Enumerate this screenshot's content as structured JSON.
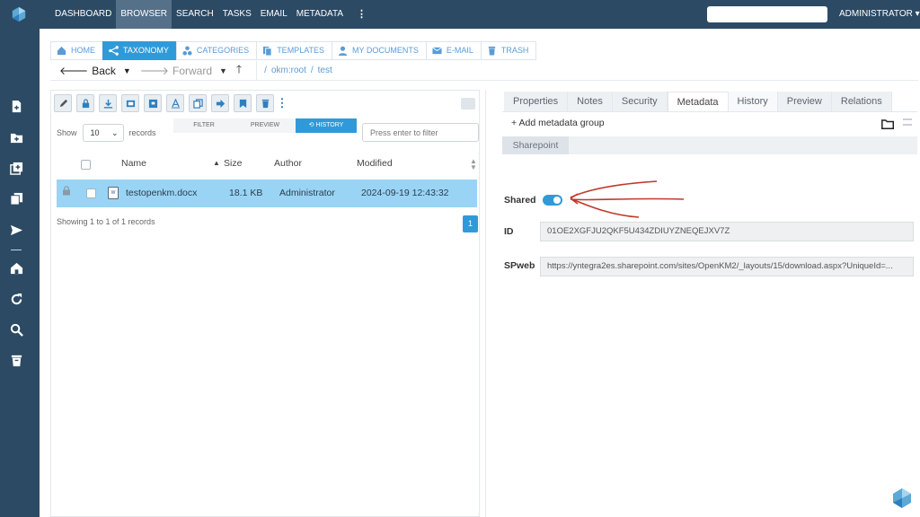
{
  "topnav": {
    "items": [
      "DASHBOARD",
      "BROWSER",
      "SEARCH",
      "TASKS",
      "EMAIL",
      "METADATA"
    ],
    "more": "⋮",
    "user": "ADMINISTRATOR ▾"
  },
  "tabs": [
    "HOME",
    "TAXONOMY",
    "CATEGORIES",
    "TEMPLATES",
    "MY DOCUMENTS",
    "E-MAIL",
    "TRASH"
  ],
  "nav": {
    "back": "Back",
    "forward": "Forward",
    "path": [
      "/",
      "okm:root",
      "/",
      "test"
    ]
  },
  "subtabs": [
    "FILTER",
    "PREVIEW",
    "⟲ HISTORY"
  ],
  "list": {
    "show_label": "Show",
    "page_size": "10",
    "records_label": "records",
    "filter_placeholder": "Press enter to filter",
    "columns": {
      "name": "Name",
      "size": "Size",
      "author": "Author",
      "modified": "Modified"
    },
    "rows": [
      {
        "name": "testopenkm.docx",
        "size": "18.1 KB",
        "author": "Administrator",
        "modified": "2024-09-19 12:43:32"
      }
    ],
    "showing": "Showing 1 to 1 of 1 records",
    "page": "1"
  },
  "properties": {
    "tabs": [
      "Properties",
      "Notes",
      "Security",
      "Metadata",
      "History",
      "Preview",
      "Relations"
    ],
    "add_group": "+ Add metadata group",
    "group_tab": "Sharepoint",
    "shared_label": "Shared",
    "shared": true,
    "id_label": "ID",
    "id_value": "01OE2XGFJU2QKF5U434ZDIUYZNEQEJXV7Z",
    "spweb_label": "SPweb",
    "spweb_value": "https://yntegra2es.sharepoint.com/sites/OpenKM2/_layouts/15/download.aspx?UniqueId=..."
  },
  "colors": {
    "brand": "#2c4a64",
    "accent": "#2f9ad9",
    "selected_row": "#99d4f5",
    "annotation": "#c0392b"
  }
}
